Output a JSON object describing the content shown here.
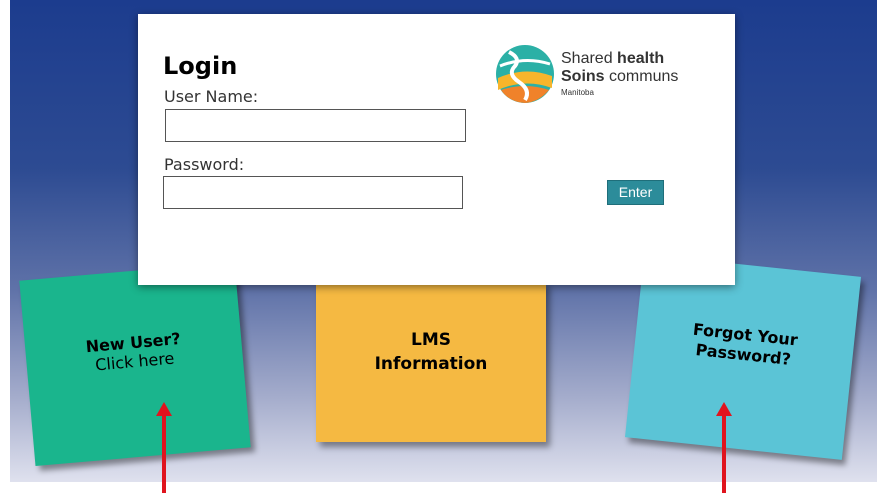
{
  "login": {
    "title": "Login",
    "username_label": "User Name:",
    "username_value": "",
    "password_label": "Password:",
    "password_value": "",
    "enter_label": "Enter"
  },
  "logo": {
    "line1_regular": "Shared",
    "line1_bold": "health",
    "line2_bold": "Soins",
    "line2_regular": "communs",
    "line3": "Manitoba"
  },
  "notes": {
    "new_user": {
      "line1": "New User?",
      "line2": "Click here",
      "color": "#1ab58d"
    },
    "lms": {
      "line1": "LMS",
      "line2": "Information",
      "color": "#f5b942"
    },
    "forgot": {
      "line1": "Forgot Your",
      "line2": "Password?",
      "color": "#5bc4d6"
    }
  },
  "colors": {
    "enter_button": "#2c8c9a",
    "arrow": "#e0141e",
    "background_top": "#1c3c8e"
  },
  "icons": [
    "shared-health-logo-icon",
    "arrow-up-icon"
  ]
}
